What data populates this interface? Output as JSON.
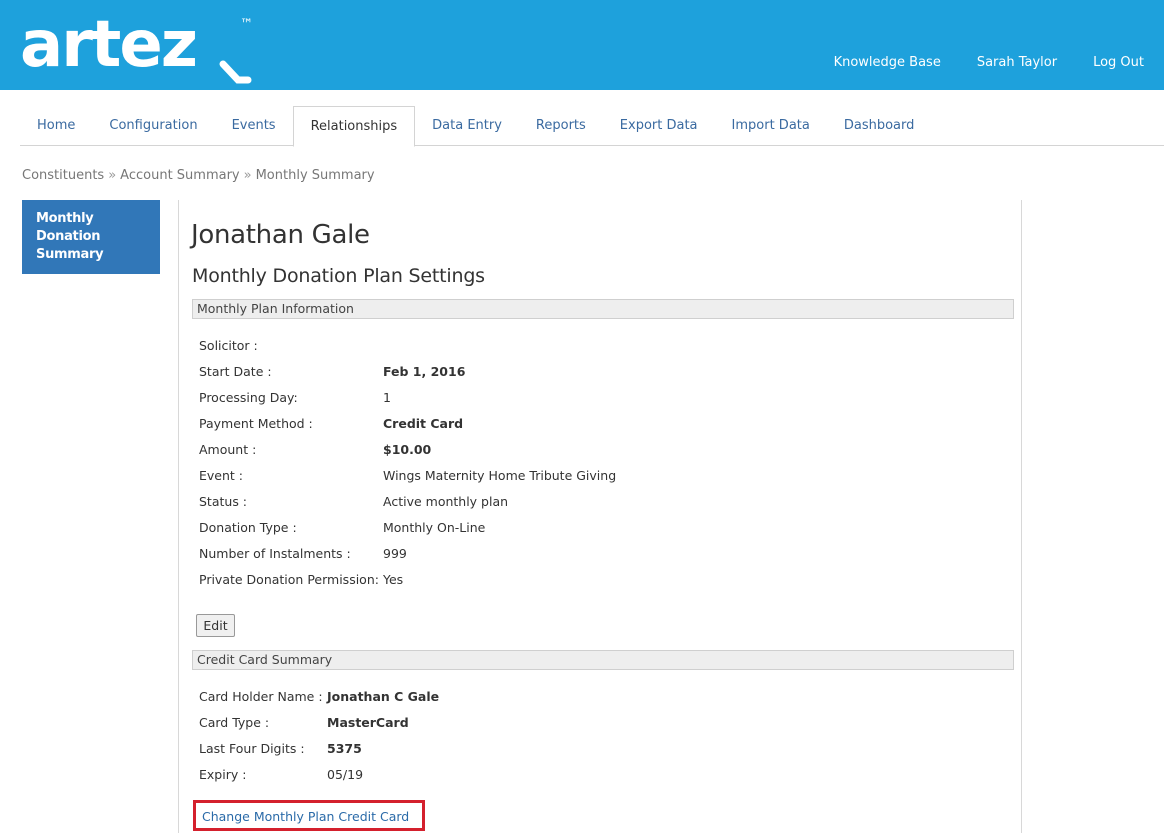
{
  "header": {
    "logo_text": "artez",
    "logo_tm": "™",
    "links": [
      "Knowledge Base",
      "Sarah Taylor",
      "Log Out"
    ]
  },
  "tabs": [
    {
      "label": "Home"
    },
    {
      "label": "Configuration"
    },
    {
      "label": "Events"
    },
    {
      "label": "Relationships",
      "active": true
    },
    {
      "label": "Data Entry"
    },
    {
      "label": "Reports"
    },
    {
      "label": "Export Data"
    },
    {
      "label": "Import Data"
    },
    {
      "label": "Dashboard"
    }
  ],
  "breadcrumb": [
    "Constituents",
    "Account Summary",
    "Monthly Summary"
  ],
  "breadcrumb_sep": "»",
  "sidebar": {
    "item": "Monthly Donation Summary"
  },
  "main": {
    "person_name": "Jonathan Gale",
    "section_title": "Monthly Donation Plan Settings",
    "plan_panel": {
      "title": "Monthly Plan Information",
      "rows": [
        {
          "label": "Solicitor :",
          "value": "",
          "bold": false
        },
        {
          "label": "Start Date :",
          "value": "Feb 1, 2016",
          "bold": true
        },
        {
          "label": "Processing Day:",
          "value": "1",
          "bold": false
        },
        {
          "label": "Payment Method :",
          "value": "Credit Card",
          "bold": true
        },
        {
          "label": "Amount :",
          "value": "$10.00",
          "bold": true
        },
        {
          "label": "Event :",
          "value": "Wings Maternity Home Tribute Giving",
          "bold": false
        },
        {
          "label": "Status :",
          "value": "Active monthly plan",
          "bold": false
        },
        {
          "label": "Donation Type :",
          "value": "Monthly On-Line",
          "bold": false
        },
        {
          "label": "Number of Instalments :",
          "value": "999",
          "bold": false
        },
        {
          "label": "Private Donation Permission:",
          "value": "Yes",
          "bold": false
        }
      ],
      "edit_label": "Edit"
    },
    "card_panel": {
      "title": "Credit Card Summary",
      "rows": [
        {
          "label": "Card Holder Name :",
          "value": "Jonathan C Gale",
          "bold": true
        },
        {
          "label": "Card Type :",
          "value": "MasterCard",
          "bold": true
        },
        {
          "label": "Last Four Digits :",
          "value": "5375",
          "bold": true
        },
        {
          "label": "Expiry :",
          "value": "05/19",
          "bold": false
        }
      ],
      "change_link": "Change Monthly Plan Credit Card"
    }
  },
  "colors": {
    "header_bg": "#1ea1dc",
    "sidebar_bg": "#3177b8",
    "link": "#3a6aa0",
    "highlight_border": "#d4202d"
  }
}
